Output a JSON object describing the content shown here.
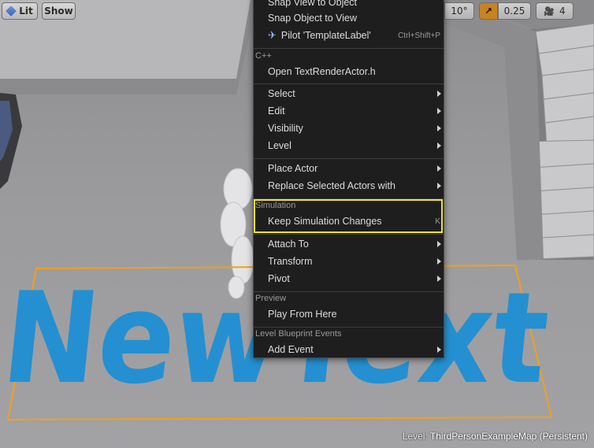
{
  "toolbar": {
    "lit_label": "Lit",
    "show_label": "Show",
    "rotation_snap": "10°",
    "scale_snap": "0.25",
    "camera_speed": "4"
  },
  "menu": {
    "items_top": [
      {
        "label": "Snap View to Object"
      },
      {
        "label": "Snap Object to View"
      },
      {
        "label": "Pilot 'TemplateLabel'",
        "shortcut": "Ctrl+Shift+P"
      }
    ],
    "cpp_section": "C++",
    "cpp_items": [
      {
        "label": "Open TextRenderActor.h"
      }
    ],
    "group1": [
      {
        "label": "Select"
      },
      {
        "label": "Edit"
      },
      {
        "label": "Visibility"
      },
      {
        "label": "Level"
      }
    ],
    "group2": [
      {
        "label": "Place Actor"
      },
      {
        "label": "Replace Selected Actors with"
      }
    ],
    "simulation_section": "Simulation",
    "simulation_items": [
      {
        "label": "Keep Simulation Changes",
        "shortcut": "K"
      }
    ],
    "group3": [
      {
        "label": "Attach To"
      },
      {
        "label": "Transform"
      },
      {
        "label": "Pivot"
      }
    ],
    "preview_section": "Preview",
    "preview_items": [
      {
        "label": "Play From Here"
      }
    ],
    "level_bp_section": "Level Blueprint Events",
    "level_bp_items": [
      {
        "label": "Add Event"
      }
    ]
  },
  "scene": {
    "floor_text": "NewText"
  },
  "status": {
    "level_label": "Level:",
    "level_name": "ThirdPersonExampleMap (Persistent)"
  },
  "colors": {
    "text_blue": "#1a8fd6",
    "selection_orange": "#f0a020",
    "highlight_yellow": "#f0e040"
  }
}
